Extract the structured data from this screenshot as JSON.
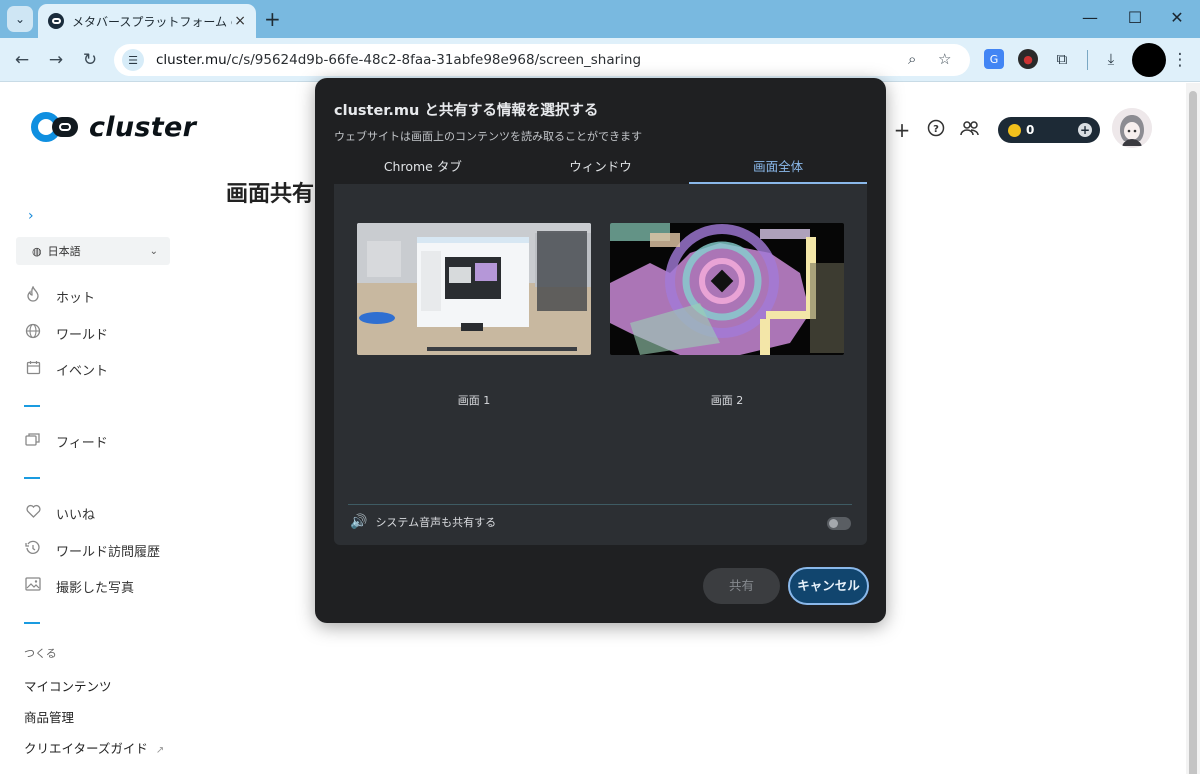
{
  "browser": {
    "tab_title": "メタバースプラットフォーム cluster（仮）",
    "tab_close": "×",
    "tab_list": "⌄",
    "new_tab": "+",
    "url_host": "cluster.mu",
    "url_path": "/c/s/95624d9b-66fe-48c2-8faa-31abfe98e968/screen_sharing",
    "window": {
      "minimize": "—",
      "maximize": "☐",
      "close": "✕"
    }
  },
  "site": {
    "logo_text": "cluster",
    "page_title": "画面共有",
    "coins": "0",
    "language": "日本語"
  },
  "sidebar": {
    "nav": [
      {
        "label": "ホット",
        "icon": "flame-icon"
      },
      {
        "label": "ワールド",
        "icon": "globe-icon"
      },
      {
        "label": "イベント",
        "icon": "calendar-icon"
      },
      {
        "label": "フィード",
        "icon": "feed-icon"
      },
      {
        "label": "いいね",
        "icon": "heart-icon"
      },
      {
        "label": "ワールド訪問履歴",
        "icon": "history-icon"
      },
      {
        "label": "撮影した写真",
        "icon": "photo-icon"
      }
    ],
    "create_label": "つくる",
    "create_items": [
      "マイコンテンツ",
      "商品管理",
      "クリエイターズガイド"
    ]
  },
  "dialog": {
    "title": "cluster.mu と共有する情報を選択する",
    "subtitle": "ウェブサイトは画面上のコンテンツを読み取ることができます",
    "tabs": [
      "Chrome タブ",
      "ウィンドウ",
      "画面全体"
    ],
    "active_tab": "画面全体",
    "screens": [
      "画面 1",
      "画面 2"
    ],
    "audio_label": "システム音声も共有する",
    "audio_enabled": false,
    "share_label": "共有",
    "cancel_label": "キャンセル"
  },
  "colors": {
    "brand_blue": "#0f8fe0",
    "dialog_bg": "#1f2022",
    "panel_bg": "#2c2f33",
    "accent": "#8ab8ea",
    "cancel_bg": "#11456e"
  }
}
